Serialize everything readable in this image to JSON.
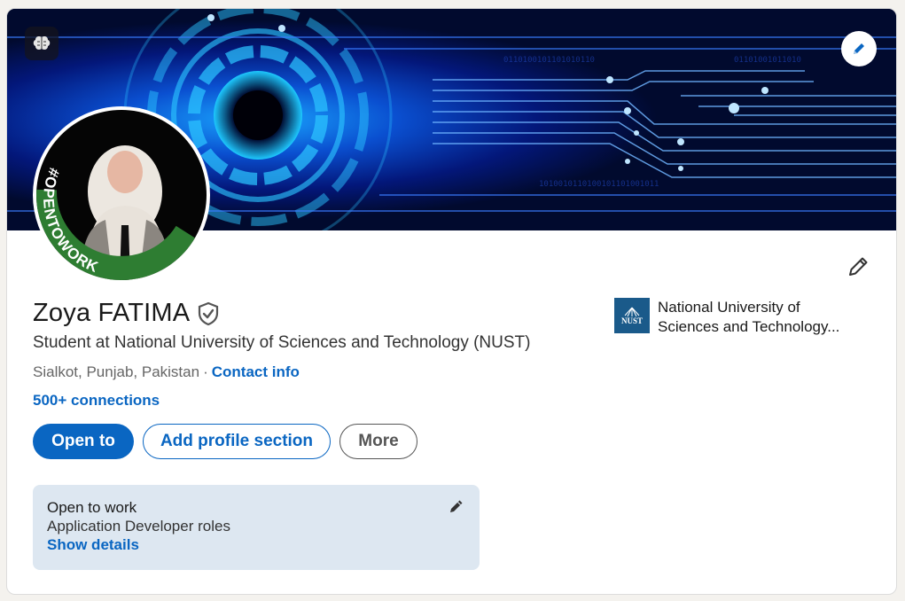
{
  "profile": {
    "name": "Zoya FATIMA",
    "headline": "Student at National University of Sciences and Technology (NUST)",
    "location": "Sialkot, Punjab, Pakistan",
    "separator": "·",
    "contact_info": "Contact info",
    "connections": "500+ connections",
    "avatar_frame_text": "#OPENTOWORK"
  },
  "actions": {
    "open_to": "Open to",
    "add_section": "Add profile section",
    "more": "More"
  },
  "open_to_work": {
    "title": "Open to work",
    "roles": "Application Developer roles",
    "link": "Show details"
  },
  "education": {
    "name_line1": "National University of",
    "name_line2": "Sciences and Technology...",
    "logo_text": "NUST"
  },
  "icons": {
    "banner_badge": "brain-icon",
    "banner_edit": "pencil-icon",
    "profile_edit": "pencil-icon",
    "verified": "shield-check-icon",
    "otw_edit": "pencil-icon"
  },
  "colors": {
    "accent": "#0a66c2",
    "open_to_work_bg": "#dde7f1",
    "open_to_work_ring": "#2e7d32",
    "banner_bg": "#010a2e"
  }
}
